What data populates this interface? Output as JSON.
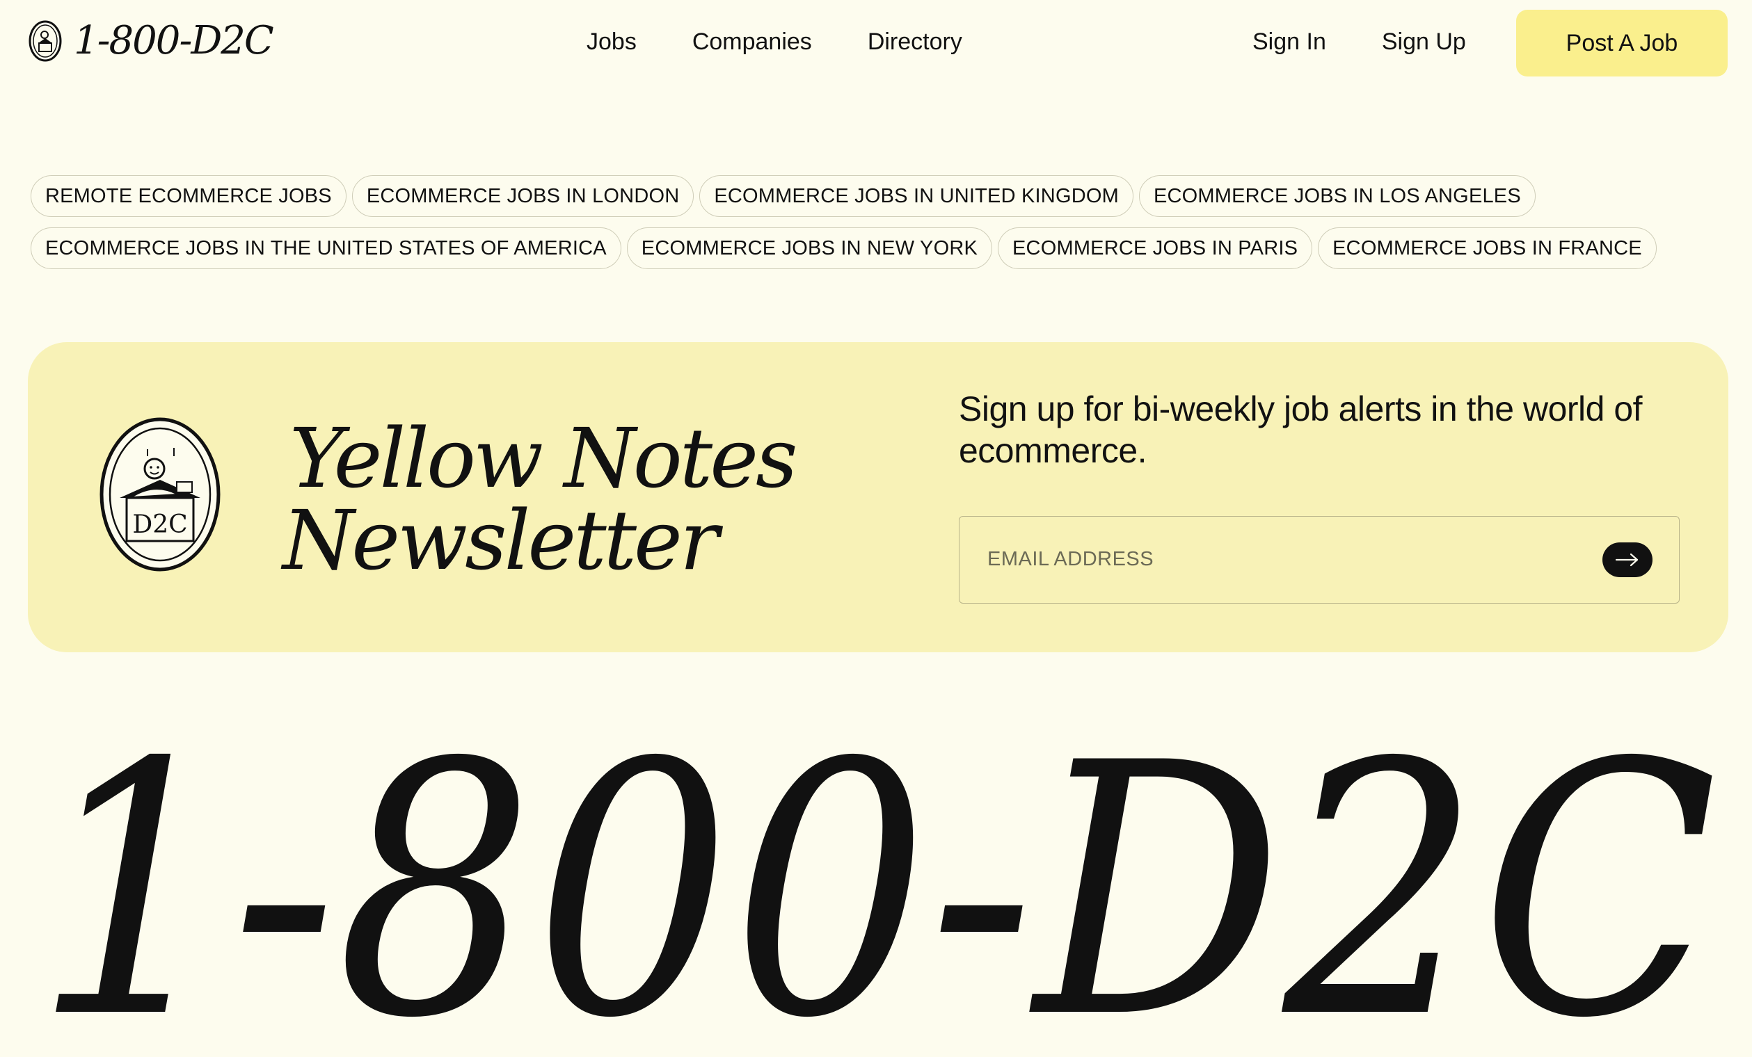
{
  "brand": {
    "name": "1-800-D2C"
  },
  "nav": {
    "links": [
      "Jobs",
      "Companies",
      "Directory"
    ],
    "sign_in": "Sign In",
    "sign_up": "Sign Up",
    "post_job": "Post A Job"
  },
  "tags": {
    "row1": [
      "REMOTE ECOMMERCE JOBS",
      "ECOMMERCE JOBS IN LONDON",
      "ECOMMERCE JOBS IN UNITED KINGDOM",
      "ECOMMERCE JOBS IN LOS ANGELES"
    ],
    "row2": [
      "ECOMMERCE JOBS IN THE UNITED STATES OF AMERICA",
      "ECOMMERCE JOBS IN NEW YORK",
      "ECOMMERCE JOBS IN PARIS",
      "ECOMMERCE JOBS IN FRANCE"
    ]
  },
  "newsletter": {
    "title_line1": "Yellow Notes",
    "title_line2": "Newsletter",
    "badge_text": "D2C",
    "description": "Sign up for bi-weekly job alerts in the world of ecommerce.",
    "email_placeholder": "EMAIL ADDRESS",
    "email_value": ""
  },
  "footer_wordmark": "1-800-D2C",
  "icons": {
    "logo": "mascot-badge-icon",
    "submit": "arrow-right-icon"
  },
  "colors": {
    "background": "#fdfcee",
    "accent_yellow": "#faef8d",
    "newsletter_bg": "#f8f2b7",
    "text": "#111111"
  }
}
